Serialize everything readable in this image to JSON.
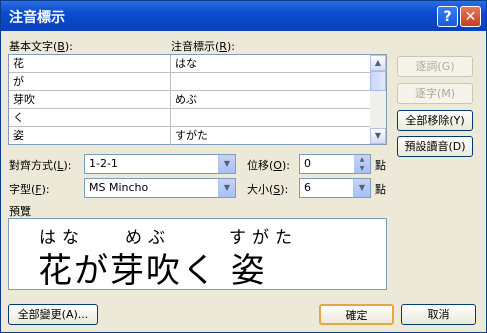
{
  "window": {
    "title": "注音標示"
  },
  "labels": {
    "base_text": "基本文字(",
    "base_key": "B",
    "base_end": "):",
    "phonetic": "注音標示(",
    "phonetic_key": "R",
    "phonetic_end": "):",
    "alignment": "對齊方式(",
    "alignment_key": "L",
    "alignment_end": "):",
    "font": "字型(",
    "font_key": "F",
    "font_end": "):",
    "offset": "位移(",
    "offset_key": "O",
    "offset_end": "):",
    "size": "大小(",
    "size_key": "S",
    "size_end": "):",
    "pt1": "點",
    "pt2": "點",
    "preview": "預覽"
  },
  "rows": [
    {
      "base": "花",
      "ruby": "はな"
    },
    {
      "base": "が",
      "ruby": ""
    },
    {
      "base": "芽吹",
      "ruby": "めぶ"
    },
    {
      "base": "く",
      "ruby": ""
    },
    {
      "base": "姿",
      "ruby": "すがた"
    }
  ],
  "buttons": {
    "group": "逐詞(G)",
    "mono": "逐字(M)",
    "clear_all": "全部移除(Y)",
    "default_reading": "預設讀音(D)",
    "apply_all": "全部變更(A)...",
    "ok": "確定",
    "cancel": "取消"
  },
  "fields": {
    "alignment": "1-2-1",
    "font": "MS Mincho",
    "offset": "0",
    "size": "6"
  },
  "preview": {
    "ruby_hana": "はな",
    "ruby_mebu": "めぶ",
    "ruby_sugata": "すがた",
    "base_text": "花が芽吹く 姿"
  }
}
